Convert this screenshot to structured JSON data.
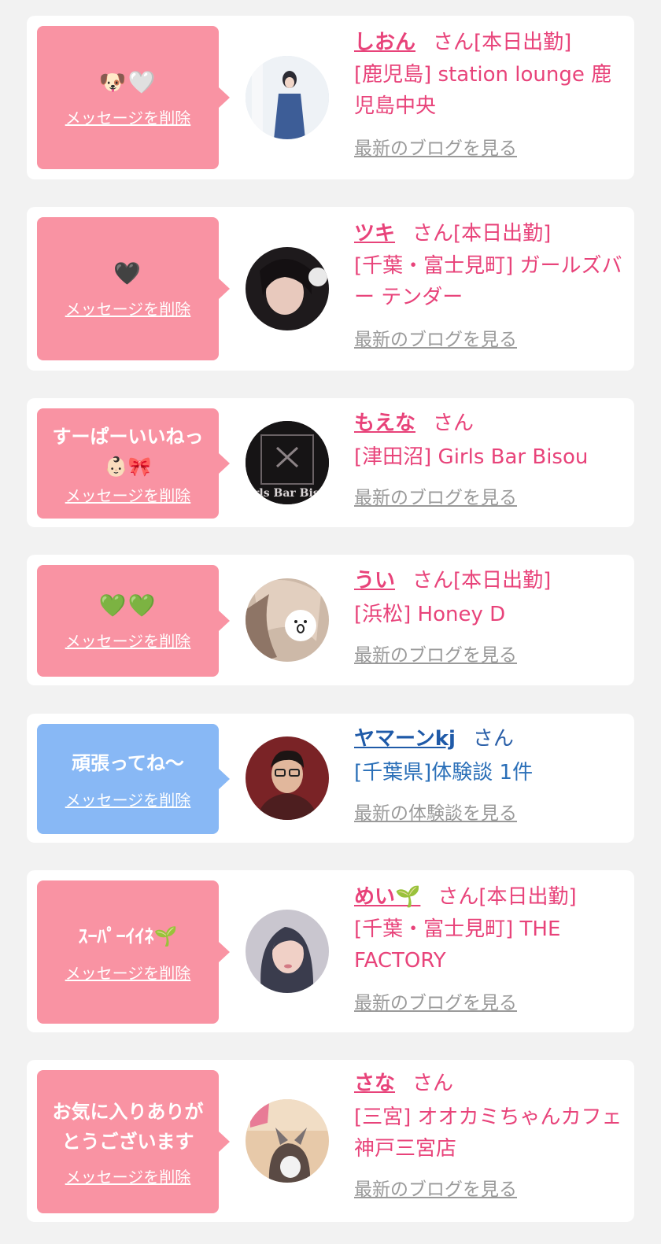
{
  "cards": [
    {
      "message": "🐶🤍",
      "delete_label": "メッセージを削除",
      "name": "しおん",
      "name_suffix": "さん[本日出勤]",
      "shop": "[鹿児島] station lounge 鹿児島中央",
      "latest_link": "最新のブログを見る",
      "theme": "pink"
    },
    {
      "message": "🖤",
      "delete_label": "メッセージを削除",
      "name": "ツキ",
      "name_suffix": "さん[本日出勤]",
      "shop": "[千葉・富士見町] ガールズバー テンダー",
      "latest_link": "最新のブログを見る",
      "theme": "pink"
    },
    {
      "message": "すーぱーいいねっ\n👶🏻🎀",
      "delete_label": "メッセージを削除",
      "name": "もえな",
      "name_suffix": "さん",
      "shop": "[津田沼] Girls Bar Bisou",
      "latest_link": "最新のブログを見る",
      "theme": "pink",
      "avatar_text": "Girls Bar Bisou"
    },
    {
      "message": "💚💚",
      "delete_label": "メッセージを削除",
      "name": "うい",
      "name_suffix": "さん[本日出勤]",
      "shop": "[浜松] Honey D",
      "latest_link": "最新のブログを見る",
      "theme": "pink"
    },
    {
      "message": "頑張ってね〜",
      "delete_label": "メッセージを削除",
      "name": "ヤマーンkj",
      "name_suffix": "さん",
      "shop": "[千葉県]体験談 1件",
      "latest_link": "最新の体験談を見る",
      "theme": "blue"
    },
    {
      "message": "ｽｰﾊﾟｰｲｲﾈ🌱",
      "delete_label": "メッセージを削除",
      "name": "めい🌱",
      "name_suffix": "さん[本日出勤]",
      "shop": "[千葉・富士見町] THE FACTORY",
      "latest_link": "最新のブログを見る",
      "theme": "pink"
    },
    {
      "message": "お気に入りありが\nとうございます",
      "delete_label": "メッセージを削除",
      "name": "さな",
      "name_suffix": "さん",
      "shop": "[三宮] オオカミちゃんカフェ神戸三宮店",
      "latest_link": "最新のブログを見る",
      "theme": "pink"
    }
  ],
  "colors": {
    "page_bg": "#f2f2f2",
    "card_bg": "#ffffff",
    "bubble_pink": "#f993a3",
    "bubble_blue": "#88b8f5",
    "cast_text": "#e8437a",
    "user_text": "#2a6fb8",
    "link_gray": "#9a9a9a"
  }
}
